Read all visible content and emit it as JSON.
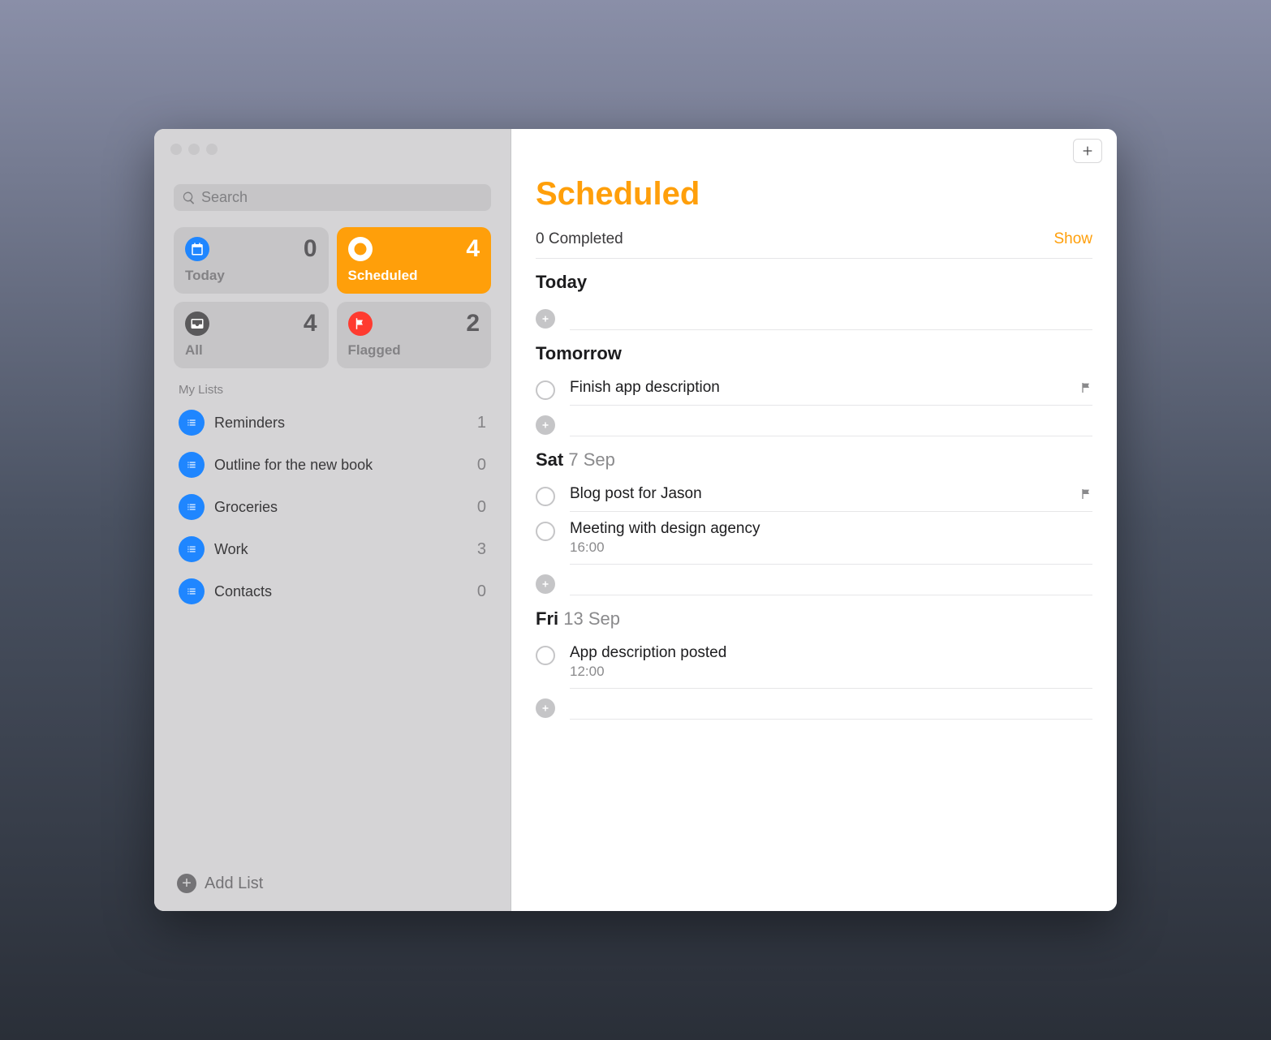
{
  "search": {
    "placeholder": "Search"
  },
  "overview": [
    {
      "id": "today",
      "label": "Today",
      "count": "0",
      "iconColor": "#1f86ff",
      "selected": false
    },
    {
      "id": "scheduled",
      "label": "Scheduled",
      "count": "4",
      "iconColor": "#ff9f0a",
      "selected": true
    },
    {
      "id": "all",
      "label": "All",
      "count": "4",
      "iconColor": "#5a595b",
      "selected": false
    },
    {
      "id": "flagged",
      "label": "Flagged",
      "count": "2",
      "iconColor": "#ff3b30",
      "selected": false
    }
  ],
  "myListsLabel": "My Lists",
  "lists": [
    {
      "label": "Reminders",
      "count": "1"
    },
    {
      "label": "Outline for the new book",
      "count": "0"
    },
    {
      "label": "Groceries",
      "count": "0"
    },
    {
      "label": "Work",
      "count": "3"
    },
    {
      "label": "Contacts",
      "count": "0"
    }
  ],
  "addListLabel": "Add List",
  "page": {
    "title": "Scheduled",
    "completedLabel": "0 Completed",
    "showLabel": "Show"
  },
  "groups": [
    {
      "headerBold": "Today",
      "headerSoft": "",
      "items": []
    },
    {
      "headerBold": "Tomorrow",
      "headerSoft": "",
      "items": [
        {
          "title": "Finish app description",
          "time": "",
          "flagged": true
        }
      ]
    },
    {
      "headerBold": "Sat",
      "headerSoft": "7 Sep",
      "items": [
        {
          "title": "Blog post for Jason",
          "time": "",
          "flagged": true
        },
        {
          "title": "Meeting with design agency",
          "time": "16:00",
          "flagged": false
        }
      ]
    },
    {
      "headerBold": "Fri",
      "headerSoft": "13 Sep",
      "items": [
        {
          "title": "App description posted",
          "time": "12:00",
          "flagged": false
        }
      ]
    }
  ]
}
